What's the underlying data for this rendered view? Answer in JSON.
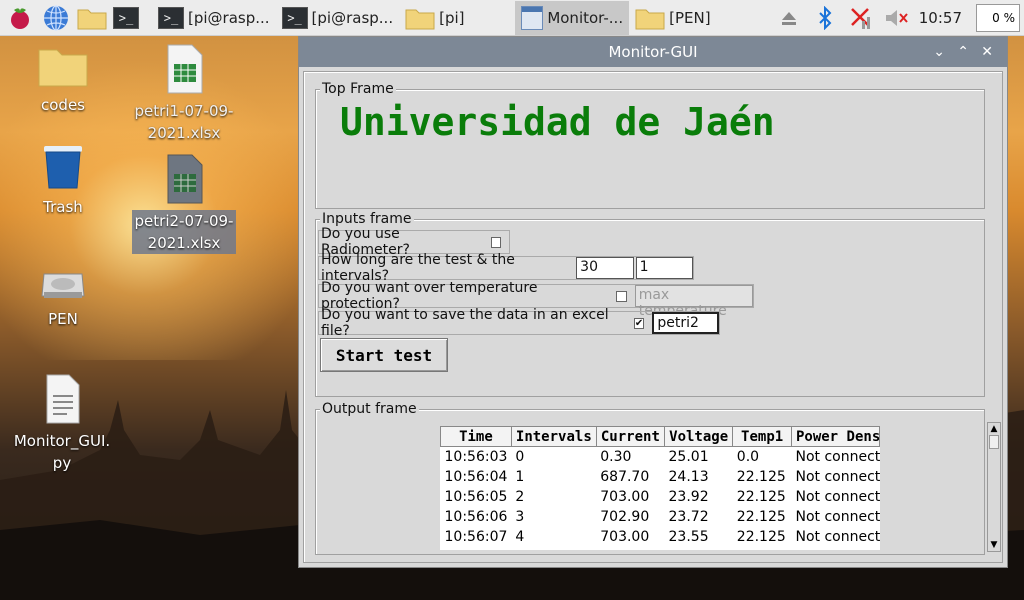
{
  "taskbar": {
    "tasks": [
      {
        "label": ""
      },
      {
        "label": "[pi@rasp..."
      },
      {
        "label": "[pi@rasp..."
      },
      {
        "label": "[pi]"
      },
      {
        "label": "Monitor-..."
      },
      {
        "label": "[PEN]"
      }
    ],
    "clock": "10:57",
    "cpu": "0 %"
  },
  "desktop": {
    "icons": [
      {
        "label": "codes"
      },
      {
        "label": "petri1-07-09-2021.xlsx"
      },
      {
        "label": "Trash"
      },
      {
        "label": "petri2-07-09-2021.xlsx"
      },
      {
        "label": "PEN"
      },
      {
        "label": "Monitor_GUI.py"
      }
    ]
  },
  "window": {
    "title": "Monitor-GUI",
    "top_frame": {
      "title": "Top Frame",
      "heading": "Universidad de Jaén"
    },
    "inputs_frame": {
      "title": "Inputs frame",
      "radiometer_label": "Do you use Radiometer?",
      "duration_label": "How long are the test & the intervals?",
      "duration_value": "30",
      "interval_value": "1",
      "overtemp_label": "Do you want over temperature protection?",
      "max_temp_placeholder": "max temperature",
      "excel_label": "Do you want to save the data in an excel file?",
      "excel_checked_mark": "✔",
      "filename_value": "petri2",
      "start_button": "Start test"
    },
    "output_frame": {
      "title": "Output frame",
      "columns": [
        "Time",
        "Intervals",
        "Current",
        "Voltage",
        "Temp1",
        "Power Dens"
      ],
      "rows": [
        [
          "10:56:03",
          "0",
          "0.30",
          "25.01",
          "0.0",
          "Not connecte"
        ],
        [
          "10:56:04",
          "1",
          "687.70",
          "24.13",
          "22.125",
          "Not connecte"
        ],
        [
          "10:56:05",
          "2",
          "703.00",
          "23.92",
          "22.125",
          "Not connecte"
        ],
        [
          "10:56:06",
          "3",
          "702.90",
          "23.72",
          "22.125",
          "Not connecte"
        ],
        [
          "10:56:07",
          "4",
          "703.00",
          "23.55",
          "22.125",
          "Not connecte"
        ]
      ]
    }
  }
}
